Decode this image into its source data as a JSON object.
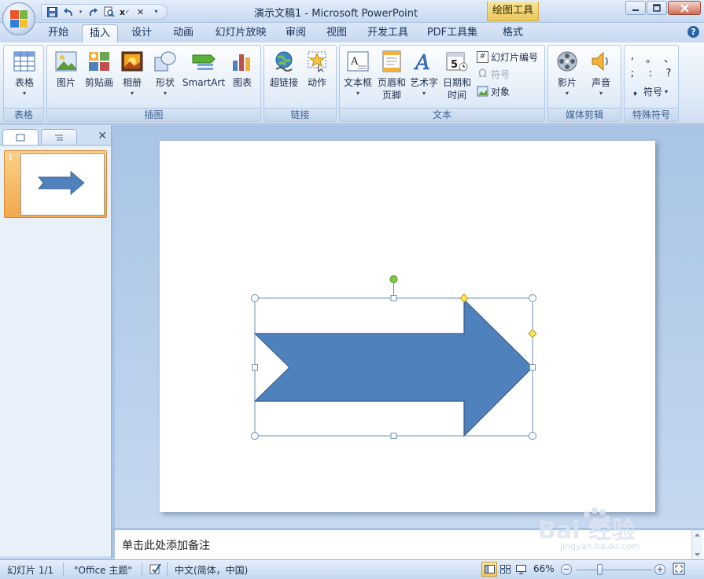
{
  "title_bar": {
    "window_title": "演示文稿1 - Microsoft PowerPoint",
    "context_tab_title": "绘图工具",
    "qat_icons": [
      "save-icon",
      "undo-icon",
      "undo-arrow-icon",
      "redo-icon",
      "print-preview-icon",
      "spelling-icon",
      "close-doc-icon",
      "customize-icon"
    ]
  },
  "tabs": [
    "开始",
    "插入",
    "设计",
    "动画",
    "幻灯片放映",
    "审阅",
    "视图",
    "开发工具",
    "PDF工具集",
    "格式"
  ],
  "active_tab": "插入",
  "ribbon": {
    "groups": {
      "tables": "表格",
      "illustrations": "插图",
      "links": "链接",
      "text": "文本",
      "media": "媒体剪辑",
      "special": "特殊符号"
    },
    "buttons": {
      "table": "表格",
      "picture": "图片",
      "clipart": "剪贴画",
      "album": "相册",
      "shapes": "形状",
      "smartart": "SmartArt",
      "chart": "图表",
      "hyperlink": "超链接",
      "action": "动作",
      "textbox": "文本框",
      "header_line1": "页眉和",
      "header_line2": "页脚",
      "wordart": "艺术字",
      "datetime_line1": "日期和",
      "datetime_line2": "时间",
      "slide_number": "幻灯片编号",
      "symbol": "符号",
      "object": "对象",
      "movie": "影片",
      "sound": "声音",
      "symbol_special": "符号"
    },
    "special_chars": [
      ",",
      "。",
      "、",
      ";",
      ":",
      "?"
    ]
  },
  "slides_pane": {
    "thumbnail_number": "1"
  },
  "notes": {
    "placeholder": "单击此处添加备注"
  },
  "status": {
    "slide": "幻灯片 1/1",
    "theme": "\"Office 主题\"",
    "language": "中文(简体，中国)",
    "zoom": "66%"
  },
  "colors": {
    "arrow_fill": "#4f81bd",
    "arrow_stroke": "#385d8a",
    "rotation_handle": "#7fc83f",
    "adjust_handle": "#ffe45c"
  },
  "watermark": {
    "brand": "Bai 经验",
    "url": "jingyan.baidu.com"
  }
}
